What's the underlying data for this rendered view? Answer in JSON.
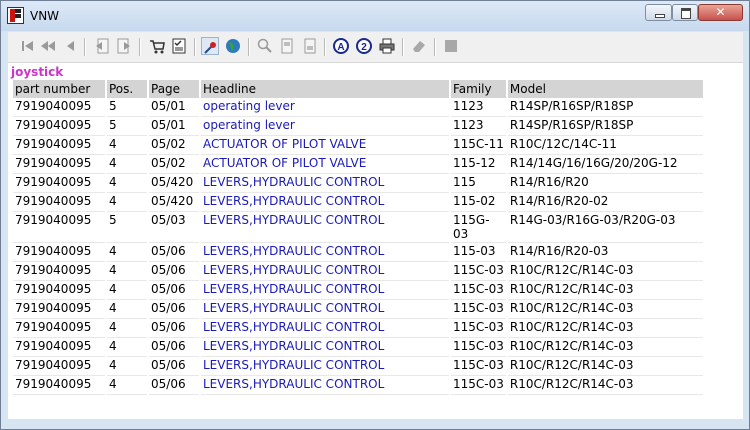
{
  "window": {
    "title": "VNW",
    "close_glyph": "✕"
  },
  "toolbar": {
    "icons": [
      "first-icon",
      "prev-page-icon",
      "prev-icon",
      "doc-back-icon",
      "doc-forward-icon",
      "cart-icon",
      "checklist-icon",
      "pin-icon",
      "globe-icon",
      "zoom-icon",
      "page-icon",
      "page-alt-icon",
      "search-a-icon",
      "search-2-icon",
      "print-icon",
      "eraser-icon",
      "stop-icon"
    ]
  },
  "group": {
    "title": "joystick"
  },
  "table": {
    "columns": [
      "part number",
      "Pos.",
      "Page",
      "Headline",
      "Family",
      "Model"
    ],
    "rows": [
      [
        "7919040095",
        "5",
        "05/01",
        "operating lever",
        "1123",
        "R14SP/R16SP/R18SP"
      ],
      [
        "7919040095",
        "5",
        "05/01",
        "operating lever",
        "1123",
        "R14SP/R16SP/R18SP"
      ],
      [
        "7919040095",
        "4",
        "05/02",
        "ACTUATOR OF PILOT VALVE",
        "115C-11",
        "R10C/12C/14C-11"
      ],
      [
        "7919040095",
        "4",
        "05/02",
        "ACTUATOR OF PILOT VALVE",
        "115-12",
        "R14/14G/16/16G/20/20G-12"
      ],
      [
        "7919040095",
        "4",
        "05/420",
        "LEVERS,HYDRAULIC CONTROL",
        "115",
        "R14/R16/R20"
      ],
      [
        "7919040095",
        "4",
        "05/420",
        "LEVERS,HYDRAULIC CONTROL",
        "115-02",
        "R14/R16/R20-02"
      ],
      [
        "7919040095",
        "5",
        "05/03",
        "LEVERS,HYDRAULIC CONTROL",
        "115G-03",
        "R14G-03/R16G-03/R20G-03"
      ],
      [
        "7919040095",
        "4",
        "05/06",
        "LEVERS,HYDRAULIC CONTROL",
        "115-03",
        "R14/R16/R20-03"
      ],
      [
        "7919040095",
        "4",
        "05/06",
        "LEVERS,HYDRAULIC CONTROL",
        "115C-03",
        "R10C/R12C/R14C-03"
      ],
      [
        "7919040095",
        "4",
        "05/06",
        "LEVERS,HYDRAULIC CONTROL",
        "115C-03",
        "R10C/R12C/R14C-03"
      ],
      [
        "7919040095",
        "4",
        "05/06",
        "LEVERS,HYDRAULIC CONTROL",
        "115C-03",
        "R10C/R12C/R14C-03"
      ],
      [
        "7919040095",
        "4",
        "05/06",
        "LEVERS,HYDRAULIC CONTROL",
        "115C-03",
        "R10C/R12C/R14C-03"
      ],
      [
        "7919040095",
        "4",
        "05/06",
        "LEVERS,HYDRAULIC CONTROL",
        "115C-03",
        "R10C/R12C/R14C-03"
      ],
      [
        "7919040095",
        "4",
        "05/06",
        "LEVERS,HYDRAULIC CONTROL",
        "115C-03",
        "R10C/R12C/R14C-03"
      ],
      [
        "7919040095",
        "4",
        "05/06",
        "LEVERS,HYDRAULIC CONTROL",
        "115C-03",
        "R10C/R12C/R14C-03"
      ]
    ]
  }
}
